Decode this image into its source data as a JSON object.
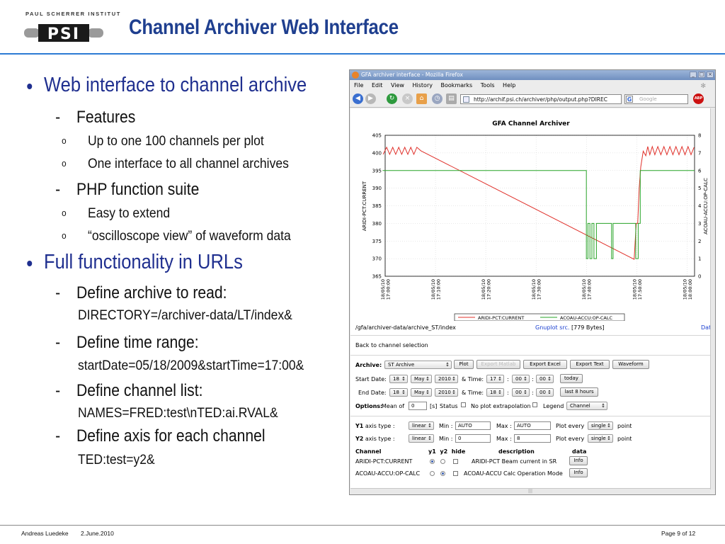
{
  "header": {
    "institute": "PAUL SCHERRER INSTITUT",
    "logo_text": "PSI",
    "title": "Channel Archiver Web Interface"
  },
  "bullets": {
    "b1": "Web interface to channel archive",
    "features": "Features",
    "f1": "Up to one 100 channels per plot",
    "f2": "One interface to all channel archives",
    "php": "PHP function suite",
    "p1": "Easy to extend",
    "p2": "“oscilloscope view” of waveform data",
    "b2": "Full functionality in URLs",
    "d1": "Define archive to read:",
    "d1_code": "DIRECTORY=/archiver-data/LT/index&",
    "d2": "Define time range:",
    "d2_code": "startDate=05/18/2009&startTime=17:00&",
    "d3": "Define channel list:",
    "d3_code": "NAMES=FRED:test\\nTED:ai.RVAL&",
    "d4": "Define axis for each channel",
    "d4_code": "TED:test=y2&",
    "dash": "-",
    "sub_marker": "o"
  },
  "browser": {
    "window_title": "GFA archiver interface - Mozilla Firefox",
    "menu": [
      "File",
      "Edit",
      "View",
      "History",
      "Bookmarks",
      "Tools",
      "Help"
    ],
    "url": "http://archif.psi.ch/archiver/php/output.php?DIREC",
    "search_placeholder": "Google",
    "abp": "ABP"
  },
  "chart_data": {
    "type": "line",
    "title": "GFA Channel Archiver",
    "ylabel": "ARIDI-PCT:CURRENT",
    "y2label": "ACOAU-ACCU:OP-CALC",
    "ylim": [
      365,
      405
    ],
    "y2lim": [
      0,
      8
    ],
    "yticks": [
      365,
      370,
      375,
      380,
      385,
      390,
      395,
      400,
      405
    ],
    "y2ticks": [
      0,
      1,
      2,
      3,
      4,
      5,
      6,
      7,
      8
    ],
    "xlim_min": [
      0,
      61.5
    ],
    "xticks": [
      {
        "t": 0,
        "date": "18/05/10",
        "time": "17:00:00"
      },
      {
        "t": 10,
        "date": "18/05/10",
        "time": "17:10:00"
      },
      {
        "t": 20,
        "date": "18/05/10",
        "time": "17:20:00"
      },
      {
        "t": 30,
        "date": "18/05/10",
        "time": "17:30:00"
      },
      {
        "t": 40,
        "date": "18/05/10",
        "time": "17:40:00"
      },
      {
        "t": 50,
        "date": "18/05/10",
        "time": "17:50:00"
      },
      {
        "t": 60,
        "date": "18/05/10",
        "time": "18:00:00"
      }
    ],
    "grid": true,
    "legend_position": "bottom",
    "series": [
      {
        "name": "ARIDI-PCT:CURRENT",
        "axis": "y1",
        "color": "#e0302a",
        "x": [
          -0.4,
          0.3,
          0.9,
          1.5,
          2.1,
          2.7,
          3.3,
          3.9,
          4.5,
          5.1,
          5.7,
          6.3,
          7.1,
          49.5,
          49.9,
          50.2,
          50.5,
          50.8,
          51.3,
          51.8,
          52.2,
          52.6,
          53.1,
          53.6,
          54.2,
          54.8,
          55.4,
          56.0,
          56.6,
          57.2,
          57.8,
          58.4,
          59.0,
          59.6,
          60.2,
          60.8,
          61.4
        ],
        "y": [
          399.6,
          401.6,
          399.6,
          401.6,
          399.6,
          401.6,
          399.6,
          401.6,
          399.6,
          401.6,
          399.6,
          401.6,
          400.6,
          369.8,
          380.0,
          380.0,
          390.0,
          396.0,
          400.5,
          399.2,
          401.8,
          399.5,
          401.8,
          399.5,
          401.8,
          399.5,
          401.8,
          399.5,
          401.8,
          399.5,
          401.8,
          399.5,
          401.8,
          399.5,
          401.8,
          399.5,
          401.6
        ]
      },
      {
        "name": "ACOAU-ACCU:OP-CALC",
        "axis": "y2",
        "color": "#27a327",
        "x": [
          -0.5,
          40.0,
          40.0,
          40.3,
          40.3,
          40.7,
          40.7,
          41.1,
          41.1,
          41.5,
          41.5,
          42.0,
          42.0,
          45.0,
          45.0,
          45.3,
          45.3,
          49.8,
          49.8,
          50.3,
          50.3,
          50.7,
          50.7,
          61.5
        ],
        "y": [
          6,
          6,
          1,
          1,
          3,
          3,
          1,
          1,
          3,
          3,
          1,
          1,
          3,
          3,
          1,
          1,
          3,
          3,
          1,
          1,
          3,
          3,
          6,
          6
        ]
      }
    ],
    "data_source": "/gfa/archiver-data/archive_ST/index",
    "gnuplot_label": "Gnuplot src.",
    "size": "[779 Bytes]",
    "data_label": "Data"
  },
  "form": {
    "back_link": "Back to channel selection",
    "archive_label": "Archive:",
    "archive_value": "ST Archive",
    "buttons": {
      "plot": "Plot",
      "export_matlab": "Export Matlab",
      "export_excel": "Export Excel",
      "export_text": "Export Text",
      "waveform": "Waveform"
    },
    "start_date_label": "Start Date:",
    "end_date_label": "End Date:",
    "start": {
      "day": "18",
      "month": "May",
      "year": "2010",
      "h": "17",
      "m": "00",
      "s": "00"
    },
    "end": {
      "day": "18",
      "month": "May",
      "year": "2010",
      "h": "18",
      "m": "00",
      "s": "00"
    },
    "time_label": "& Time:",
    "colon": ":",
    "today": "today",
    "last8": "last 8 hours",
    "options_label": "Options:",
    "mean_of": "Mean of",
    "mean_value": "0",
    "seconds": "[s]",
    "status": "Status",
    "no_extrap": "No plot extrapolation",
    "legend_label": "Legend",
    "legend_value": "Channel",
    "y1_label": "Y1",
    "y2_label": "Y2",
    "axis_type": "axis type :",
    "y1_type": "linear",
    "y2_type": "linear",
    "min_label": "Min :",
    "max_label": "Max :",
    "y1_min": "AUTO",
    "y1_max": "AUTO",
    "y2_min": "0",
    "y2_max": "8",
    "plot_every": "Plot every",
    "y1_every": "single",
    "y2_every": "single",
    "point": "point",
    "col_channel": "Channel",
    "col_y1y2hide": "y1  y2  hide",
    "col_desc": "description",
    "col_data": "data",
    "rows": [
      {
        "channel": "ARIDI-PCT:CURRENT",
        "desc": "ARIDI-PCT Beam current in SR",
        "info": "Info"
      },
      {
        "channel": "ACOAU-ACCU:OP-CALC",
        "desc": "ACOAU-ACCU Calc Operation Mode",
        "info": "Info"
      }
    ]
  },
  "footer": {
    "author": "Andreas Luedeke",
    "date": "2.June.2010",
    "page": "Page 9 of 12"
  }
}
